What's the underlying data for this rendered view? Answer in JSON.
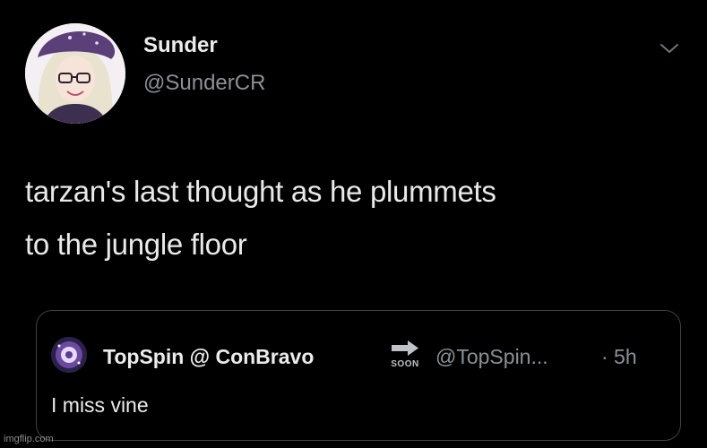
{
  "author": {
    "name": "Sunder",
    "handle": "@SunderCR",
    "avatar_icon": "anime-avatar-icon"
  },
  "tweet": {
    "text_lines": [
      "tarzan's last thought as he plummets",
      "to the jungle floor"
    ]
  },
  "quoted_tweet": {
    "name": "TopSpin @ ConBravo",
    "badge_text": "SOON",
    "badge_icon": "arrow-right-icon",
    "handle": "@TopSpin...",
    "time": "· 5h",
    "text": "I miss vine",
    "avatar_icon": "galaxy-avatar-icon"
  },
  "menu_icon": "chevron-down-icon",
  "watermark": "imgflip.com",
  "colors": {
    "background": "#000000",
    "primary_text": "#e9e9e9",
    "secondary_text": "#8b9197",
    "quote_border": "#3e4246"
  }
}
